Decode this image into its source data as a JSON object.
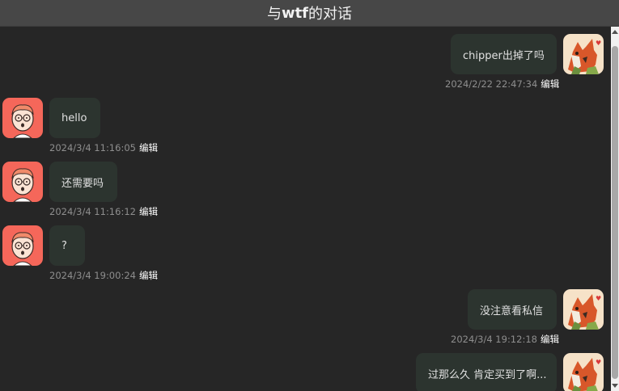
{
  "header": {
    "prefix": "与",
    "username": "wtf",
    "suffix": "的对话"
  },
  "messages": [
    {
      "side": "right",
      "avatar": "fox-avatar",
      "text": "chipper出掉了吗",
      "time": "2024/2/22 22:47:34",
      "edit": "编辑"
    },
    {
      "side": "left",
      "avatar": "cartoon-boy-avatar",
      "text": "hello",
      "time": "2024/3/4 11:16:05",
      "edit": "编辑"
    },
    {
      "side": "left",
      "avatar": "cartoon-boy-avatar",
      "text": "还需要吗",
      "time": "2024/3/4 11:16:12",
      "edit": "编辑"
    },
    {
      "side": "left",
      "avatar": "cartoon-boy-avatar",
      "text": "?",
      "time": "2024/3/4 19:00:24",
      "edit": "编辑"
    },
    {
      "side": "right",
      "avatar": "fox-avatar",
      "text": "没注意看私信",
      "time": "2024/3/4 19:12:18",
      "edit": "编辑"
    },
    {
      "side": "right",
      "avatar": "fox-avatar",
      "text": "过那么久 肯定买到了啊...",
      "time": "",
      "edit": ""
    }
  ],
  "colors": {
    "background": "#262626",
    "header": "#474747",
    "bubble": "#2c342f",
    "boy_avatar_bg": "#f5675a",
    "fox_avatar_bg": "#f6e2c8"
  }
}
